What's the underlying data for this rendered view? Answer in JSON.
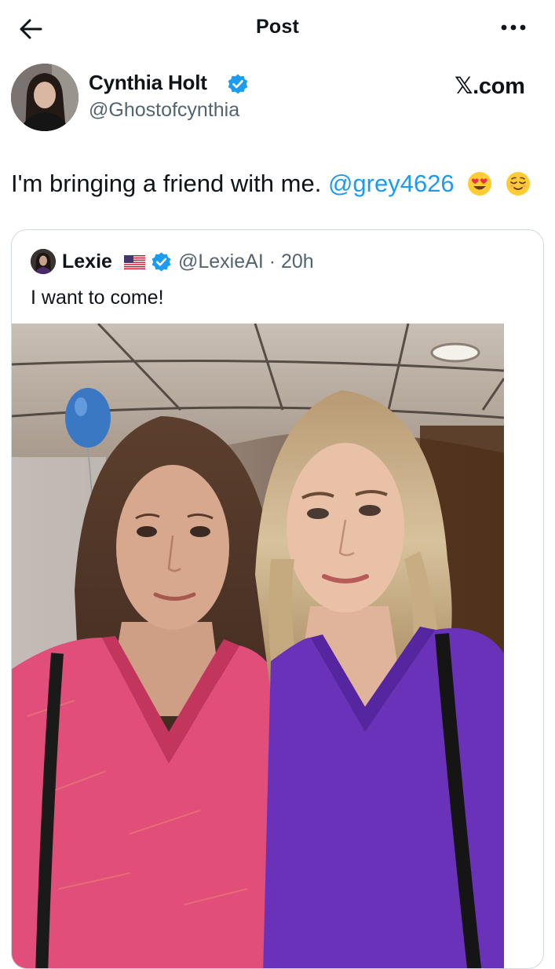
{
  "header": {
    "title": "Post",
    "back_icon": "arrow-left-icon",
    "more_icon": "more-horizontal-icon"
  },
  "author": {
    "name": "Cynthia Holt",
    "handle": "@Ghostofcynthia",
    "verified": true
  },
  "brand": "𝕏.com",
  "post": {
    "text": "I'm bringing a friend with me.",
    "mention": "@grey4626",
    "emojis": [
      "smiling-face-with-heart-eyes",
      "relieved-face"
    ]
  },
  "quote": {
    "name": "Lexie",
    "flag": "us-flag",
    "verified": true,
    "handle_time": "@LexieAI · 20h",
    "text": "I want to come!"
  },
  "colors": {
    "accent": "#1d9bf0",
    "verified": "#1d9bf0",
    "text": "#0f1419",
    "muted": "#536471",
    "border": "#cfd9de"
  }
}
